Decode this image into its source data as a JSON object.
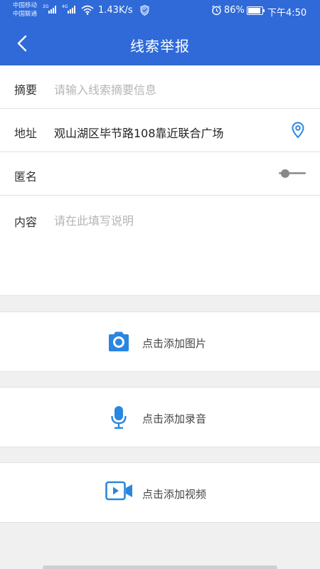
{
  "status_bar": {
    "carrier_1": "中国移动",
    "carrier_2": "中国联通",
    "net_1": "2G",
    "net_2": "4G",
    "speed": "1.43K/s",
    "battery_percent": "86%",
    "time": "下午4:50"
  },
  "header": {
    "title": "线索举报"
  },
  "form": {
    "summary": {
      "label": "摘要",
      "placeholder": "请输入线索摘要信息"
    },
    "address": {
      "label": "地址",
      "value": "观山湖区毕节路108靠近联合广场"
    },
    "anonymous": {
      "label": "匿名",
      "enabled": false
    },
    "content": {
      "label": "内容",
      "placeholder": "请在此填写说明"
    }
  },
  "media": {
    "image": {
      "label": "点击添加图片",
      "icon": "camera-icon"
    },
    "audio": {
      "label": "点击添加录音",
      "icon": "microphone-icon"
    },
    "video": {
      "label": "点击添加视频",
      "icon": "video-camera-icon"
    }
  },
  "colors": {
    "primary": "#2f6ad8",
    "icon_blue": "#2a86e0"
  }
}
